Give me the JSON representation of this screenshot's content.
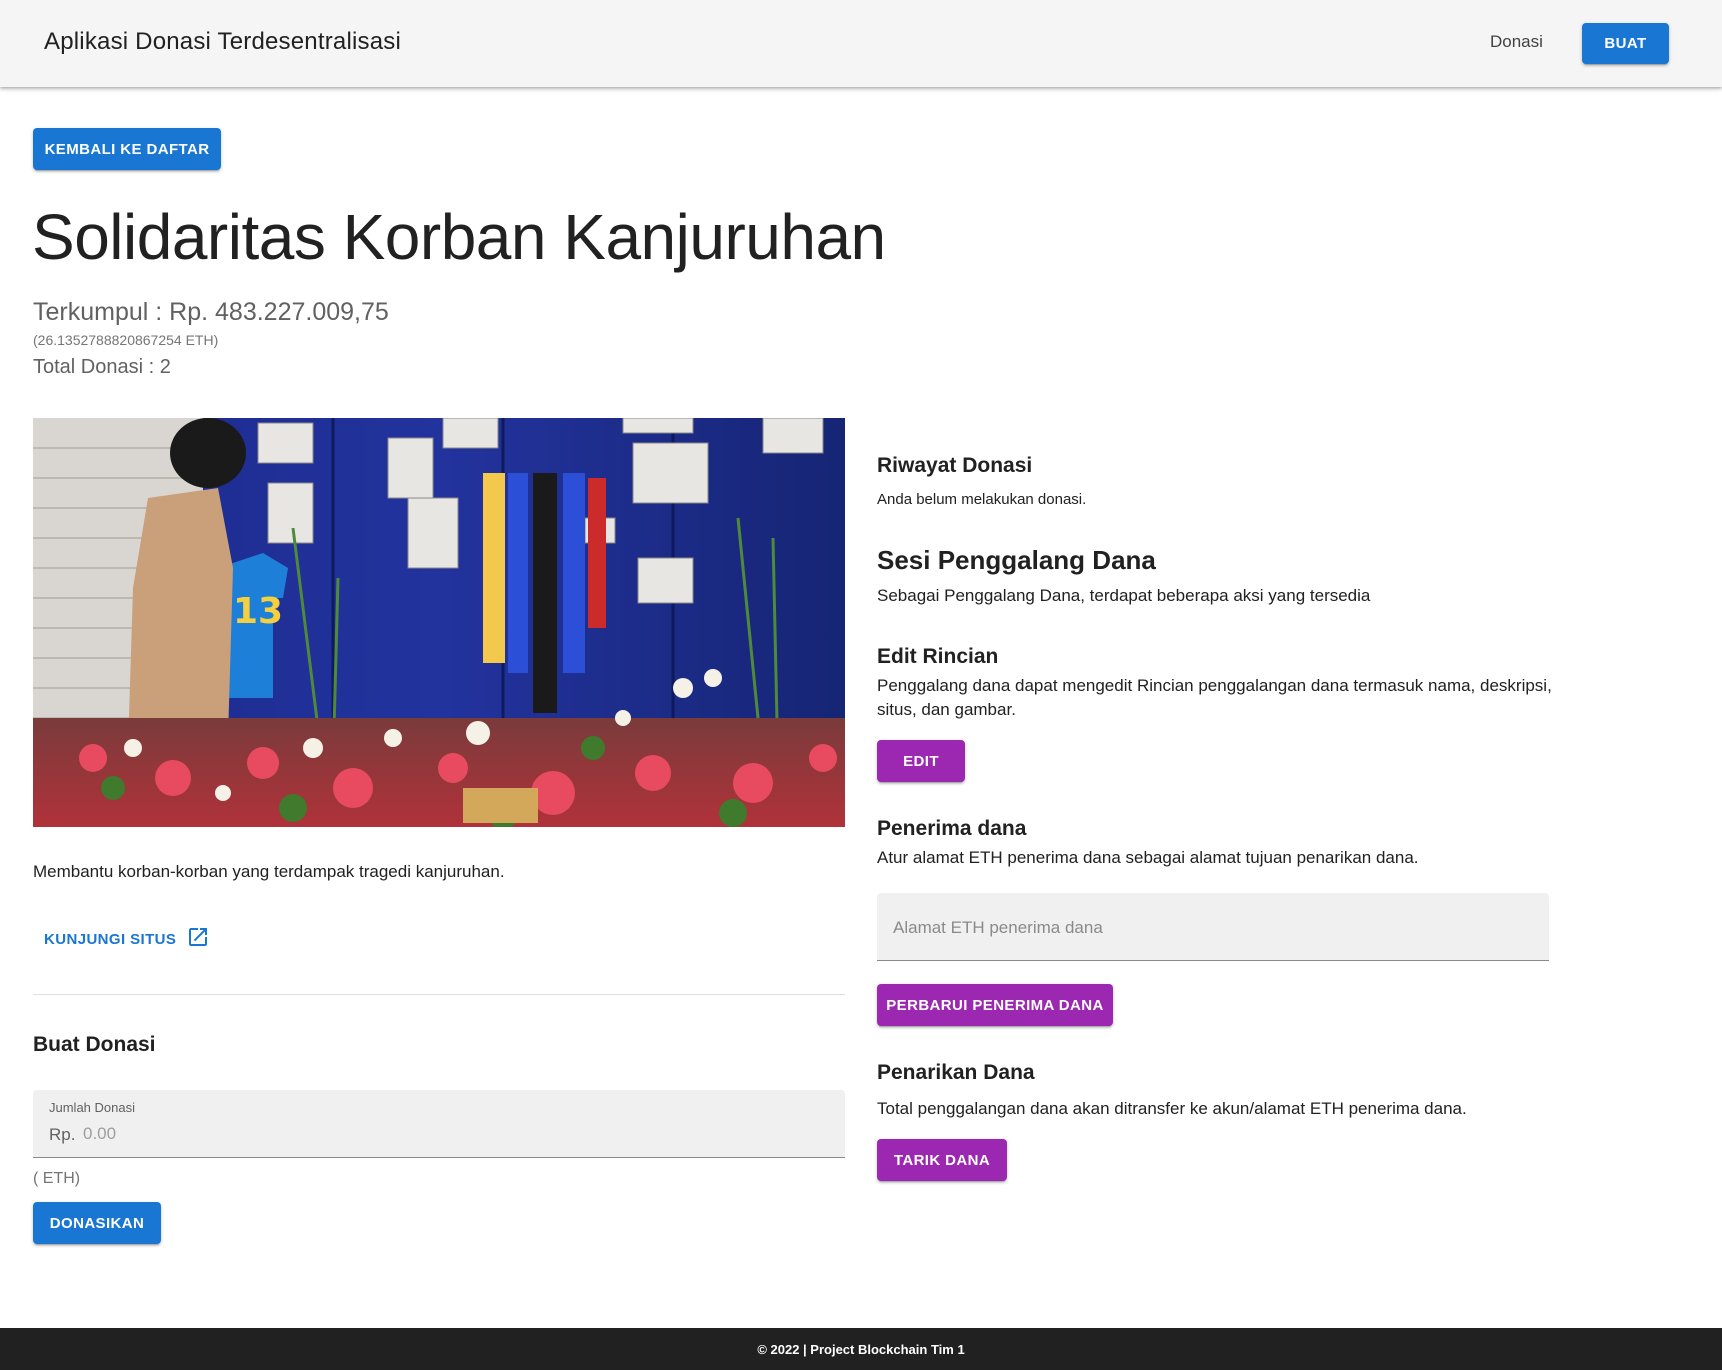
{
  "appbar": {
    "title": "Aplikasi Donasi Terdesentralisasi",
    "nav_donasi": "Donasi",
    "buat_label": "BUAT"
  },
  "back_button": "KEMBALI KE DAFTAR",
  "campaign": {
    "title": "Solidaritas Korban Kanjuruhan",
    "collected": "Terkumpul : Rp. 483.227.009,75",
    "collected_eth": "(26.1352788820867254 ETH)",
    "total_donasi": "Total Donasi : 2",
    "description": "Membantu korban-korban yang terdampak tragedi kanjuruhan.",
    "visit_link": "KUNJUNGI SITUS",
    "image_alt": "Solidaritas Korban Kanjuruhan"
  },
  "donate": {
    "heading": "Buat Donasi",
    "field_label": "Jumlah Donasi",
    "prefix": "Rp.",
    "placeholder": "0.00",
    "value": "",
    "eth_note": "( ETH)",
    "button": "DONASIKAN"
  },
  "history": {
    "heading": "Riwayat Donasi",
    "empty_text": "Anda belum melakukan donasi."
  },
  "fundraiser": {
    "heading": "Sesi Penggalang Dana",
    "subtitle": "Sebagai Penggalang Dana, terdapat beberapa aksi yang tersedia",
    "edit": {
      "heading": "Edit Rincian",
      "text": "Penggalang dana dapat mengedit Rincian penggalangan dana termasuk nama, deskripsi, situs, dan gambar.",
      "button": "EDIT"
    },
    "recipient": {
      "heading": "Penerima dana",
      "text": "Atur alamat ETH penerima dana sebagai alamat tujuan penarikan dana.",
      "placeholder": "Alamat ETH penerima dana",
      "value": "",
      "button": "PERBARUI PENERIMA DANA"
    },
    "withdraw": {
      "heading": "Penarikan Dana",
      "text": "Total penggalangan dana akan ditransfer ke akun/alamat ETH penerima dana.",
      "button": "TARIK DANA"
    }
  },
  "footer": "© 2022 | Project Blockchain Tim 1",
  "colors": {
    "primary": "#1976d2",
    "secondary": "#9c27b0",
    "appbar_bg": "#f5f5f5",
    "footer_bg": "#212121"
  },
  "icons": {
    "visit_link_icon": "open-in-new-icon"
  }
}
